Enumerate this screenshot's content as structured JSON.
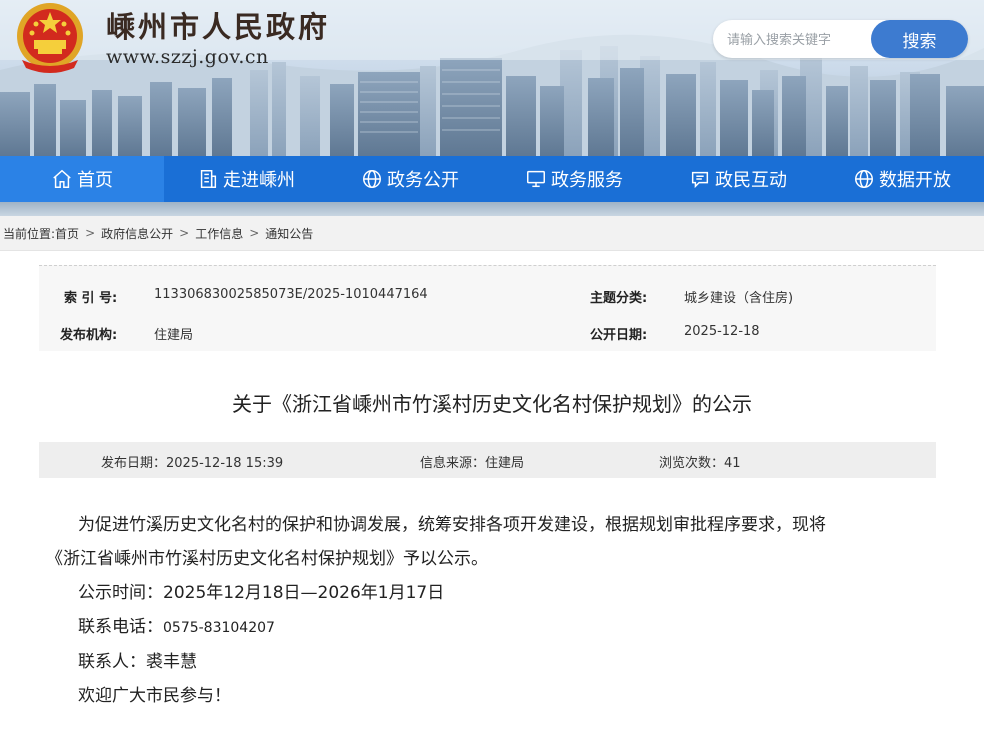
{
  "header": {
    "site_title": "嵊州市人民政府",
    "site_url": "www.szzj.gov.cn",
    "search_placeholder": "请输入搜索关键字",
    "search_button": "搜索"
  },
  "nav": {
    "items": [
      {
        "label": "首页",
        "icon": "home-icon"
      },
      {
        "label": "走进嵊州",
        "icon": "building-icon"
      },
      {
        "label": "政务公开",
        "icon": "globe-icon"
      },
      {
        "label": "政务服务",
        "icon": "monitor-icon"
      },
      {
        "label": "政民互动",
        "icon": "chat-icon"
      },
      {
        "label": "数据开放",
        "icon": "globe-icon"
      }
    ]
  },
  "breadcrumb": {
    "prefix": "当前位置:",
    "items": [
      "首页",
      "政府信息公开",
      "工作信息",
      "通知公告"
    ]
  },
  "meta": {
    "index_label": "索 引 号:",
    "index_value": "11330683002585073E/2025-1010447164",
    "topic_label": "主题分类:",
    "topic_value": "城乡建设（含住房)",
    "org_label": "发布机构:",
    "org_value": "住建局",
    "open_date_label": "公开日期:",
    "open_date_value": "2025-12-18"
  },
  "article": {
    "title": "关于《浙江省嵊州市竹溪村历史文化名村保护规划》的公示",
    "publish_date": "发布日期：2025-12-18 15:39",
    "source": "信息来源：住建局",
    "views": "浏览次数：41",
    "para1_line1": "为促进竹溪历史文化名村的保护和协调发展，统筹安排各项开发建设，根据规划审批程序要求，现将",
    "para1_line2": "《浙江省嵊州市竹溪村历史文化名村保护规划》予以公示。",
    "period_label": "公示时间：",
    "period_value": "2025年12月18日—2026年1月17日",
    "phone_label": "联系电话：",
    "phone_value": "0575-83104207",
    "contact_label": "联系人：",
    "contact_value": "裘丰慧",
    "closing": "欢迎广大市民参与！"
  }
}
